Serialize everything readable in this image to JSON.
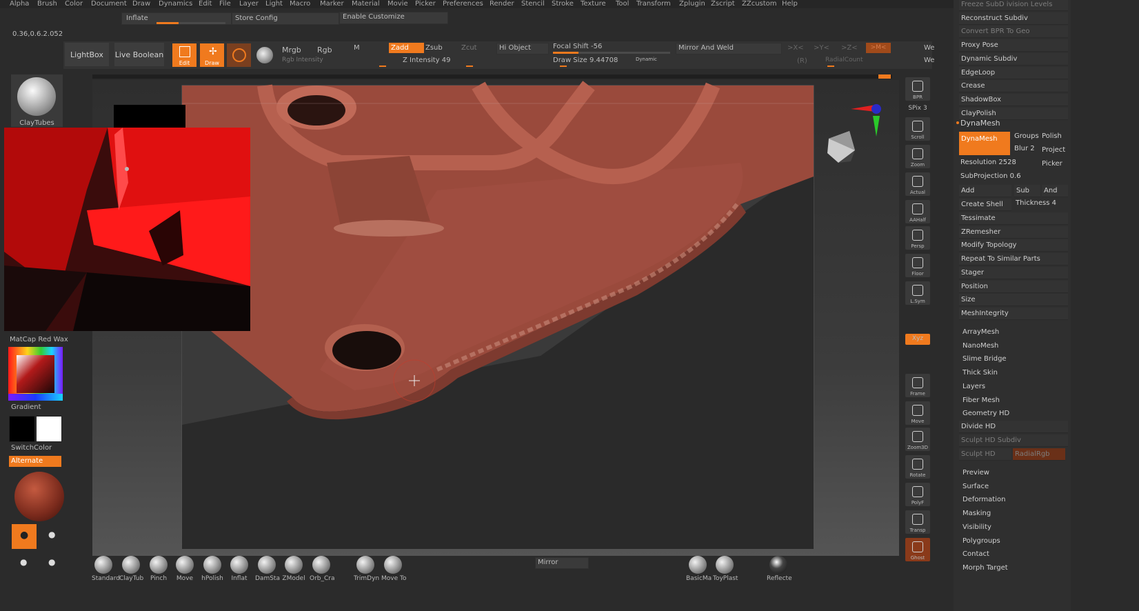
{
  "menu": [
    "Alpha",
    "Brush",
    "Color",
    "Document",
    "Draw",
    "Dynamics",
    "Edit",
    "File",
    "Layer",
    "Light",
    "Macro",
    "Marker",
    "Material",
    "Movie",
    "Picker",
    "Preferences",
    "Render",
    "Stencil",
    "Stroke",
    "Texture",
    "Tool",
    "Transform",
    "Zplugin",
    "Zscript",
    "ZZcustom",
    "Help"
  ],
  "version": "0.36,0.6.2.052",
  "sub_toolbar": {
    "inflate": "Inflate",
    "store_config": "Store Config",
    "enable_customize": "Enable Customize"
  },
  "toolbar": {
    "lightbox": "LightBox",
    "live_boolean": "Live Boolean",
    "edit": "Edit",
    "draw": "Draw",
    "mrgb": "Mrgb",
    "rgb": "Rgb",
    "m": "M",
    "rgb_intensity": "Rgb Intensity",
    "zadd": "Zadd",
    "zsub": "Zsub",
    "zcut": "Zcut",
    "z_intensity": "Z Intensity 49",
    "hi_object": "Hi Object",
    "focal_shift": "Focal Shift -56",
    "draw_size": "Draw Size 9.44708",
    "dynamic": "Dynamic",
    "mirror_and_weld": "Mirror And Weld",
    "x": ">X<",
    "y": ">Y<",
    "z": ">Z<",
    "m2": ">M<",
    "r": "(R)",
    "radial_count": "RadialCount",
    "we1": "We",
    "we2": "We"
  },
  "left_shelf": {
    "brush_name": "ClayTubes",
    "material_name": "MatCap Red Wax",
    "gradient": "Gradient",
    "switch_color": "SwitchColor",
    "alternate": "Alternate"
  },
  "right_icons": [
    "BPR",
    "SPix 3",
    "Scroll",
    "Zoom",
    "Actual",
    "AAHalf",
    "Persp",
    "Floor",
    "L.Sym",
    "",
    "Xyz",
    "",
    "",
    "Frame",
    "Move",
    "Zoom3D",
    "Rotate",
    "PolyF",
    "Transp",
    "Ghost",
    ""
  ],
  "right_panel": {
    "top_items": [
      {
        "label": "Freeze SubD ivision Levels",
        "dim": true
      },
      {
        "label": "Reconstruct Subdiv",
        "dim": false
      },
      {
        "label": "Convert BPR To Geo",
        "dim": true
      },
      {
        "label": "Proxy Pose",
        "dim": false
      },
      {
        "label": "Dynamic Subdiv",
        "dim": false
      },
      {
        "label": "EdgeLoop",
        "dim": false
      },
      {
        "label": "Crease",
        "dim": false
      },
      {
        "label": "ShadowBox",
        "dim": false
      },
      {
        "label": "ClayPolish",
        "dim": false
      }
    ],
    "dynamesh_header": "DynaMesh",
    "dynamesh_button": "DynaMesh",
    "groups": "Groups",
    "polish": "Polish",
    "blur": "Blur 2",
    "project": "Project",
    "resolution": "Resolution 2528",
    "picker": "Picker",
    "subprojection": "SubProjection 0.6",
    "add": "Add",
    "sub": "Sub",
    "and": "And",
    "create_shell": "Create Shell",
    "thickness": "Thickness 4",
    "mid_items": [
      "Tessimate",
      "ZRemesher",
      "Modify Topology",
      "Repeat To Similar Parts",
      "Stager",
      "Position",
      "Size",
      "MeshIntegrity"
    ],
    "sub_items1": [
      "ArrayMesh",
      "NanoMesh",
      "Slime Bridge",
      "Thick Skin",
      "Layers",
      "Fiber Mesh"
    ],
    "geometry_hd": "Geometry HD",
    "divide_hd": "Divide HD",
    "sculpt_hd_subdiv": "Sculpt HD Subdiv",
    "sculpt_hd": "Sculpt HD",
    "radial_rgb": "RadialRgb",
    "sub_items2": [
      "Preview",
      "Surface",
      "Deformation",
      "Masking",
      "Visibility",
      "Polygroups",
      "Contact",
      "Morph Target"
    ]
  },
  "bottom_brushes": [
    "Standard",
    "ClayTub",
    "Pinch",
    "Move",
    "hPolish",
    "Inflat",
    "DamSta",
    "ZModel",
    "Orb_Cra",
    "TrimDyn",
    "Move To"
  ],
  "bottom_right_brushes": [
    "BasicMa",
    "ToyPlast",
    "Reflecte"
  ],
  "mirror": "Mirror",
  "colors": {
    "accent": "#f07a1e",
    "mesh": "#9a4a3c"
  }
}
